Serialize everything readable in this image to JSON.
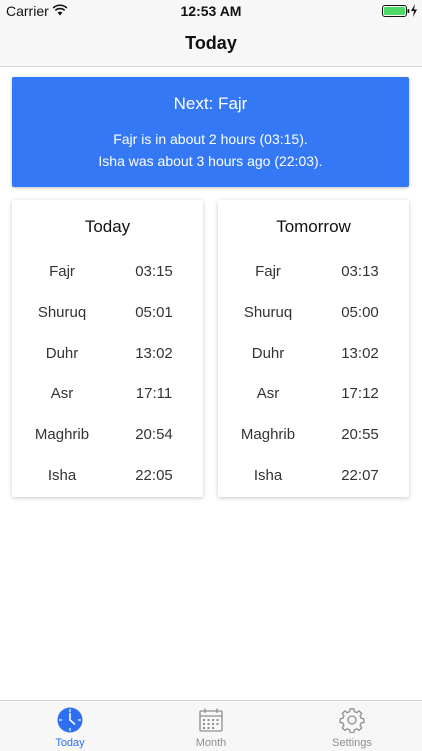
{
  "status_bar": {
    "carrier": "Carrier",
    "time": "12:53 AM"
  },
  "nav": {
    "title": "Today"
  },
  "next": {
    "title": "Next: Fajr",
    "line1": "Fajr is in about 2 hours (03:15).",
    "line2": "Isha was about 3 hours ago (22:03)."
  },
  "today": {
    "title": "Today",
    "prayers": [
      {
        "name": "Fajr",
        "time": "03:15"
      },
      {
        "name": "Shuruq",
        "time": "05:01"
      },
      {
        "name": "Duhr",
        "time": "13:02"
      },
      {
        "name": "Asr",
        "time": "17:11"
      },
      {
        "name": "Maghrib",
        "time": "20:54"
      },
      {
        "name": "Isha",
        "time": "22:05"
      }
    ]
  },
  "tomorrow": {
    "title": "Tomorrow",
    "prayers": [
      {
        "name": "Fajr",
        "time": "03:13"
      },
      {
        "name": "Shuruq",
        "time": "05:00"
      },
      {
        "name": "Duhr",
        "time": "13:02"
      },
      {
        "name": "Asr",
        "time": "17:12"
      },
      {
        "name": "Maghrib",
        "time": "20:55"
      },
      {
        "name": "Isha",
        "time": "22:07"
      }
    ]
  },
  "tabs": [
    {
      "label": "Today",
      "icon": "clock-icon",
      "active": true
    },
    {
      "label": "Month",
      "icon": "calendar-icon",
      "active": false
    },
    {
      "label": "Settings",
      "icon": "gear-icon",
      "active": false
    }
  ],
  "colors": {
    "accent": "#3478f6",
    "tab_active": "#2d6ff0",
    "tab_inactive": "#8e8e93",
    "battery": "#4cd964"
  }
}
